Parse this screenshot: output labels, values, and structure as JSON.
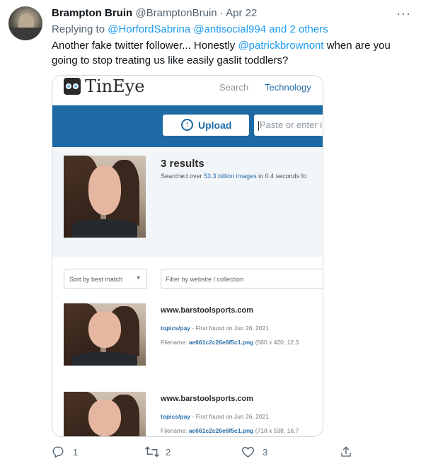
{
  "tweet": {
    "display_name": "Brampton Bruin",
    "handle": "@BramptonBruin",
    "separator": "·",
    "date": "Apr 22",
    "more": "···",
    "replying_prefix": "Replying to",
    "replying_to_1": "@HorfordSabrina",
    "replying_to_2": "@antisocial994",
    "replying_and": "and",
    "replying_others": "2 others",
    "text_part1": "Another fake twitter follower... Honestly ",
    "text_mention": "@patrickbrownont",
    "text_part2": " when are you going to stop treating us like easily gaslit toddlers?"
  },
  "tineye": {
    "logo": "TinEye",
    "nav_search": "Search",
    "nav_technology": "Technology",
    "upload_label": "Upload",
    "url_placeholder": "Paste or enter im",
    "results_count": "3 results",
    "searched_prefix": "Searched over ",
    "searched_bold": "53.3 billion images",
    "searched_suffix": " in 0.4 seconds fo",
    "sort_label": "Sort by best match",
    "filter_placeholder": "Filter by website / collection",
    "results": [
      {
        "domain": "www.barstoolsports.com",
        "path": "topics/pay",
        "found": " - First found on Jun 26, 2021",
        "filename_label": "Filename: ",
        "filename": "ae661c2c26e6f5c1.png",
        "dims": " (560 x 420, 12.3"
      },
      {
        "domain": "www.barstoolsports.com",
        "path": "topics/pay",
        "found": " - First found on Jun 26, 2021",
        "filename_label": "Filename: ",
        "filename": "ae661c2c26e6f5c1.png",
        "dims": " (718 x 538, 16.7"
      }
    ]
  },
  "actions": {
    "reply_count": "1",
    "retweet_count": "2",
    "like_count": "3"
  },
  "colors": {
    "link": "#1d9bf0",
    "tineye_blue": "#1d6aa5",
    "muted": "#536471"
  }
}
